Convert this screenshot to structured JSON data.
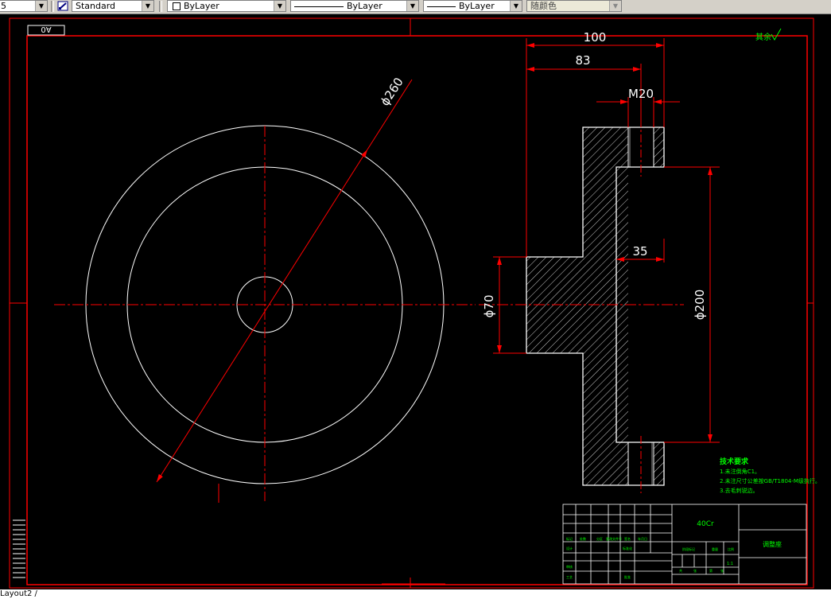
{
  "toolbar": {
    "layer_value": "5",
    "text_style": "Standard",
    "color": "ByLayer",
    "linetype": "ByLayer",
    "lineweight": "ByLayer",
    "plotstyle": "随颜色"
  },
  "drawing": {
    "stamp": "A0",
    "roughness_note": "其余",
    "dim_total_width": "100",
    "dim_inner_width": "83",
    "dim_thread": "M20",
    "dim_outer_diameter": "ϕ260",
    "dim_hub_diameter": "ϕ70",
    "dim_bore_diameter": "ϕ200",
    "dim_rim_width": "35",
    "tech_title": "技术要求",
    "tech_lines": [
      "1.未注倒角C1。",
      "2.未注尺寸公差按GB/T1804-M级执行。",
      "3.去毛刺锐边。"
    ],
    "title_block": {
      "material": "40Cr",
      "part_name": "调整座",
      "scale": "1:1",
      "labels": [
        "标记",
        "处数",
        "分区",
        "更改文件号",
        "签名",
        "年月日",
        "设计",
        "标准化",
        "审核",
        "工艺",
        "批准",
        "阶段标记",
        "重量",
        "比例",
        "共",
        "张",
        "第",
        "张"
      ]
    }
  },
  "colors": {
    "background": "#000000",
    "frame": "#ff0000",
    "geometry": "#ffffff",
    "dimension": "#ff0000",
    "annotation": "#00ff00"
  },
  "status": {
    "layout_tab": "Layout2"
  }
}
